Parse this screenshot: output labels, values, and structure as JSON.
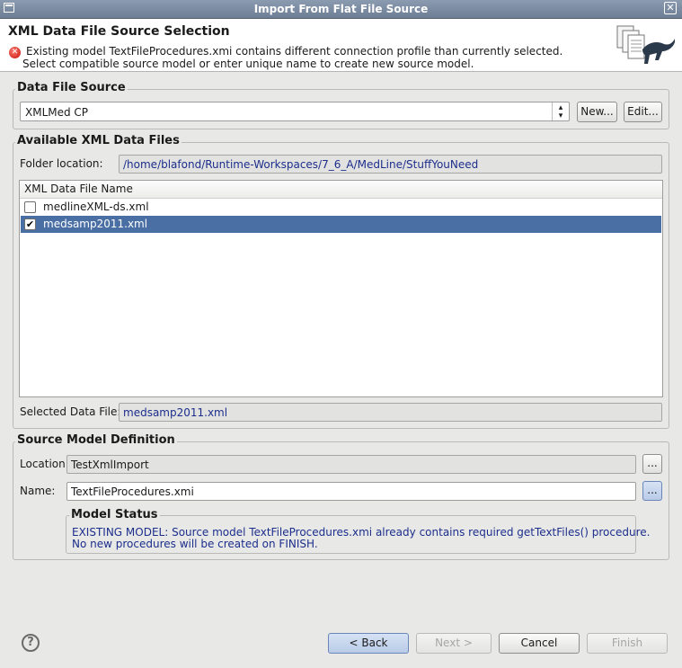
{
  "window": {
    "title": "Import From Flat File Source"
  },
  "banner": {
    "heading": "XML Data File Source Selection",
    "message_line1": "Existing model TextFileProcedures.xmi contains different connection profile than currently selected.",
    "message_line2": "Select compatible source model or enter unique name to create new source model."
  },
  "data_file_source": {
    "group_label": "Data File Source",
    "selected_profile": "XMLMed CP",
    "new_label": "New...",
    "edit_label": "Edit..."
  },
  "available_files": {
    "group_label": "Available XML Data Files",
    "folder_label": "Folder location:",
    "folder_value": "/home/blafond/Runtime-Workspaces/7_6_A/MedLine/StuffYouNeed",
    "column_header": "XML Data File Name",
    "rows": [
      {
        "name": "medlineXML-ds.xml",
        "checked": false
      },
      {
        "name": "medsamp2011.xml",
        "checked": true
      }
    ],
    "selected_label": "Selected Data File:",
    "selected_value": "medsamp2011.xml"
  },
  "source_model": {
    "group_label": "Source Model Definition",
    "location_label": "Location",
    "location_value": "TestXmlImport",
    "name_label": "Name:",
    "name_value": "TextFileProcedures.xmi",
    "browse_label": "...",
    "status_label": "Model Status",
    "status_line1": "EXISTING MODEL: Source model TextFileProcedures.xmi already contains required getTextFiles() procedure.",
    "status_line2": "No new procedures will be created on FINISH."
  },
  "buttons": {
    "help": "?",
    "back": "< Back",
    "next": "Next >",
    "cancel": "Cancel",
    "finish": "Finish"
  },
  "colors": {
    "title_bar": "#7b8ba2",
    "selection": "#4a6fa5",
    "status_text": "#1c2e8c"
  }
}
